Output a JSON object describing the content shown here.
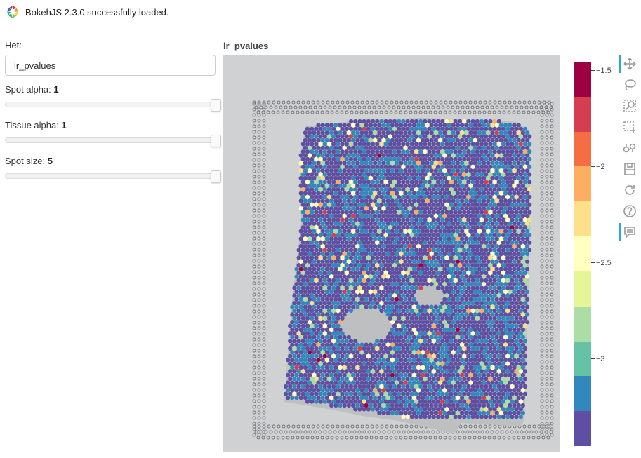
{
  "banner": {
    "message": "BokehJS 2.3.0 successfully loaded."
  },
  "controls": {
    "het": {
      "label": "Het:",
      "value": "lr_pvalues"
    },
    "spot_alpha": {
      "label": "Spot alpha: ",
      "value": "1",
      "level": 1.0
    },
    "tissue_alpha": {
      "label": "Tissue alpha: ",
      "value": "1",
      "level": 1.0
    },
    "spot_size": {
      "label": "Spot size: ",
      "value": "5",
      "level": 1.0
    }
  },
  "plot": {
    "title": "lr_pvalues"
  },
  "colorbar": {
    "palette": [
      "#9e0142",
      "#d53e4f",
      "#f46d43",
      "#fdae61",
      "#fee08b",
      "#ffffbf",
      "#e6f598",
      "#abdda4",
      "#66c2a5",
      "#3288bd",
      "#5e4fa2"
    ],
    "range": [
      -3.45,
      -1.45
    ],
    "ticks": [
      {
        "label": "−1.5",
        "value": -1.5
      },
      {
        "label": "−2",
        "value": -2.0
      },
      {
        "label": "−2.5",
        "value": -2.5
      },
      {
        "label": "−3",
        "value": -3.0
      }
    ]
  },
  "toolbar": {
    "tools": [
      {
        "name": "pan-tool",
        "icon": "move-icon",
        "active": true
      },
      {
        "name": "lasso-select-tool",
        "icon": "lasso-icon",
        "active": false
      },
      {
        "name": "wheel-zoom-tool",
        "icon": "zoom-icon",
        "active": false
      },
      {
        "name": "box-select-tool",
        "icon": "box-select-icon",
        "active": false
      },
      {
        "name": "zoom-out-tool",
        "icon": "binoculars-icon",
        "active": false
      },
      {
        "name": "save-tool",
        "icon": "save-icon",
        "active": false
      },
      {
        "name": "reset-tool",
        "icon": "reset-icon",
        "active": false
      },
      {
        "name": "help-tool",
        "icon": "help-icon",
        "active": false
      },
      {
        "name": "hover-tool",
        "icon": "hover-icon",
        "active": true
      }
    ]
  },
  "colors": {
    "spot_base": "#5e4fa2",
    "spot_mid": "#3288bd",
    "spot_hi": "#ffffbf",
    "background": "#cfd1d2"
  }
}
